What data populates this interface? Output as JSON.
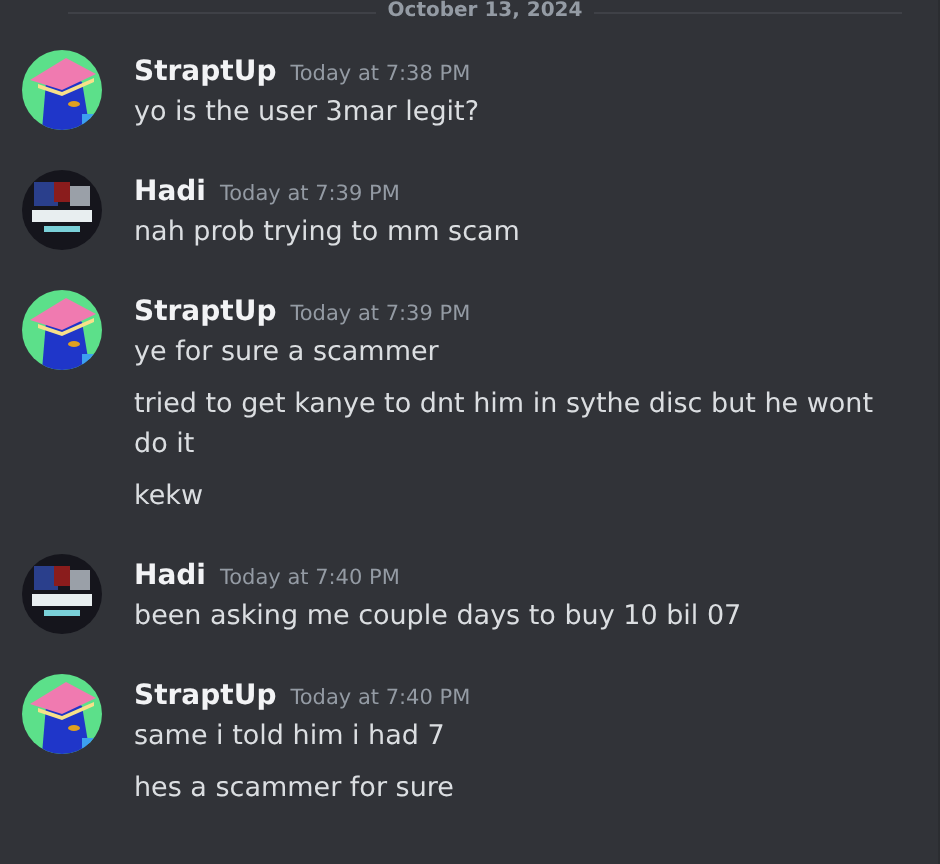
{
  "divider": {
    "label": "October 13, 2024"
  },
  "messages": [
    {
      "author": "StraptUp",
      "kind": "penguin",
      "time": "Today at 7:38 PM",
      "lines": [
        "yo is the user 3mar legit?"
      ]
    },
    {
      "author": "Hadi",
      "kind": "logo",
      "time": "Today at 7:39 PM",
      "lines": [
        "nah prob trying to mm scam"
      ]
    },
    {
      "author": "StraptUp",
      "kind": "penguin",
      "time": "Today at 7:39 PM",
      "lines": [
        "ye for sure a scammer",
        "tried to get kanye to dnt him in sythe disc but he wont do it",
        "kekw"
      ]
    },
    {
      "author": "Hadi",
      "kind": "logo",
      "time": "Today at 7:40 PM",
      "lines": [
        "been asking me couple days to buy 10 bil 07"
      ]
    },
    {
      "author": "StraptUp",
      "kind": "penguin",
      "time": "Today at 7:40 PM",
      "lines": [
        "same i told him i had 7",
        "hes a scammer for sure"
      ]
    }
  ]
}
